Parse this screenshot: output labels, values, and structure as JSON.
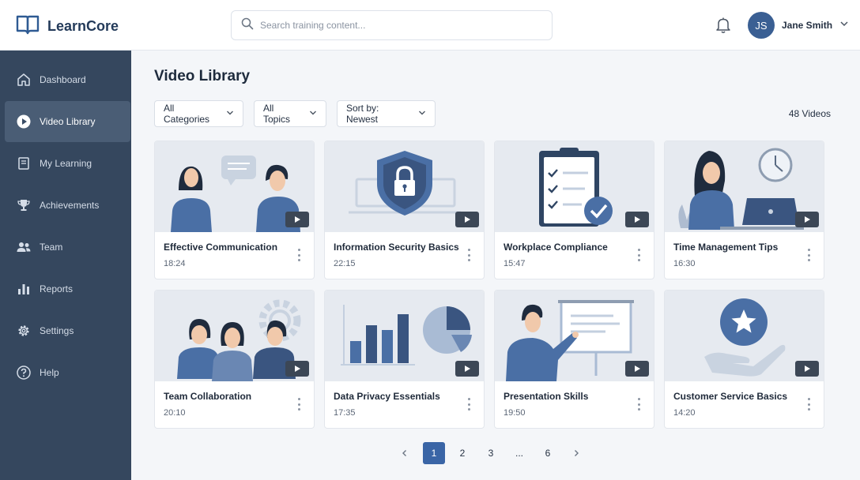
{
  "app": {
    "name": "LearnCore",
    "logo_icon": "open-book-icon"
  },
  "search": {
    "placeholder": "Search training content..."
  },
  "user": {
    "initials": "JS",
    "name": "Jane Smith"
  },
  "sidebar": {
    "items": [
      {
        "label": "Dashboard",
        "icon": "home-icon",
        "active": false
      },
      {
        "label": "Video Library",
        "icon": "play-circle-icon",
        "active": true
      },
      {
        "label": "My Learning",
        "icon": "book-icon",
        "active": false
      },
      {
        "label": "Achievements",
        "icon": "trophy-icon",
        "active": false
      },
      {
        "label": "Team",
        "icon": "users-icon",
        "active": false
      },
      {
        "label": "Reports",
        "icon": "bar-chart-icon",
        "active": false
      },
      {
        "label": "Settings",
        "icon": "gear-icon",
        "active": false
      },
      {
        "label": "Help",
        "icon": "question-circle-icon",
        "active": false
      }
    ]
  },
  "main": {
    "title": "Video Library",
    "filters": {
      "category": "All Categories",
      "topic": "All Topics",
      "sort": "Sort by: Newest"
    },
    "count": "48 Videos",
    "videos": [
      {
        "title": "Effective Communication",
        "duration": "18:24"
      },
      {
        "title": "Information Security Basics",
        "duration": "22:15"
      },
      {
        "title": "Workplace Compliance",
        "duration": "15:47"
      },
      {
        "title": "Time Management Tips",
        "duration": "16:30"
      },
      {
        "title": "Team Collaboration",
        "duration": "20:10"
      },
      {
        "title": "Data Privacy Essentials",
        "duration": "17:35"
      },
      {
        "title": "Presentation Skills",
        "duration": "19:50"
      },
      {
        "title": "Customer Service Basics",
        "duration": "14:20"
      }
    ],
    "pagination": {
      "pages": [
        "1",
        "2",
        "3",
        "...",
        "6"
      ],
      "current": "1"
    }
  },
  "colors": {
    "accent": "#3a65a6",
    "sidebar": "#35475e",
    "sidebar_active": "#4a5d75",
    "illustration_blue": "#4a6fa5"
  }
}
